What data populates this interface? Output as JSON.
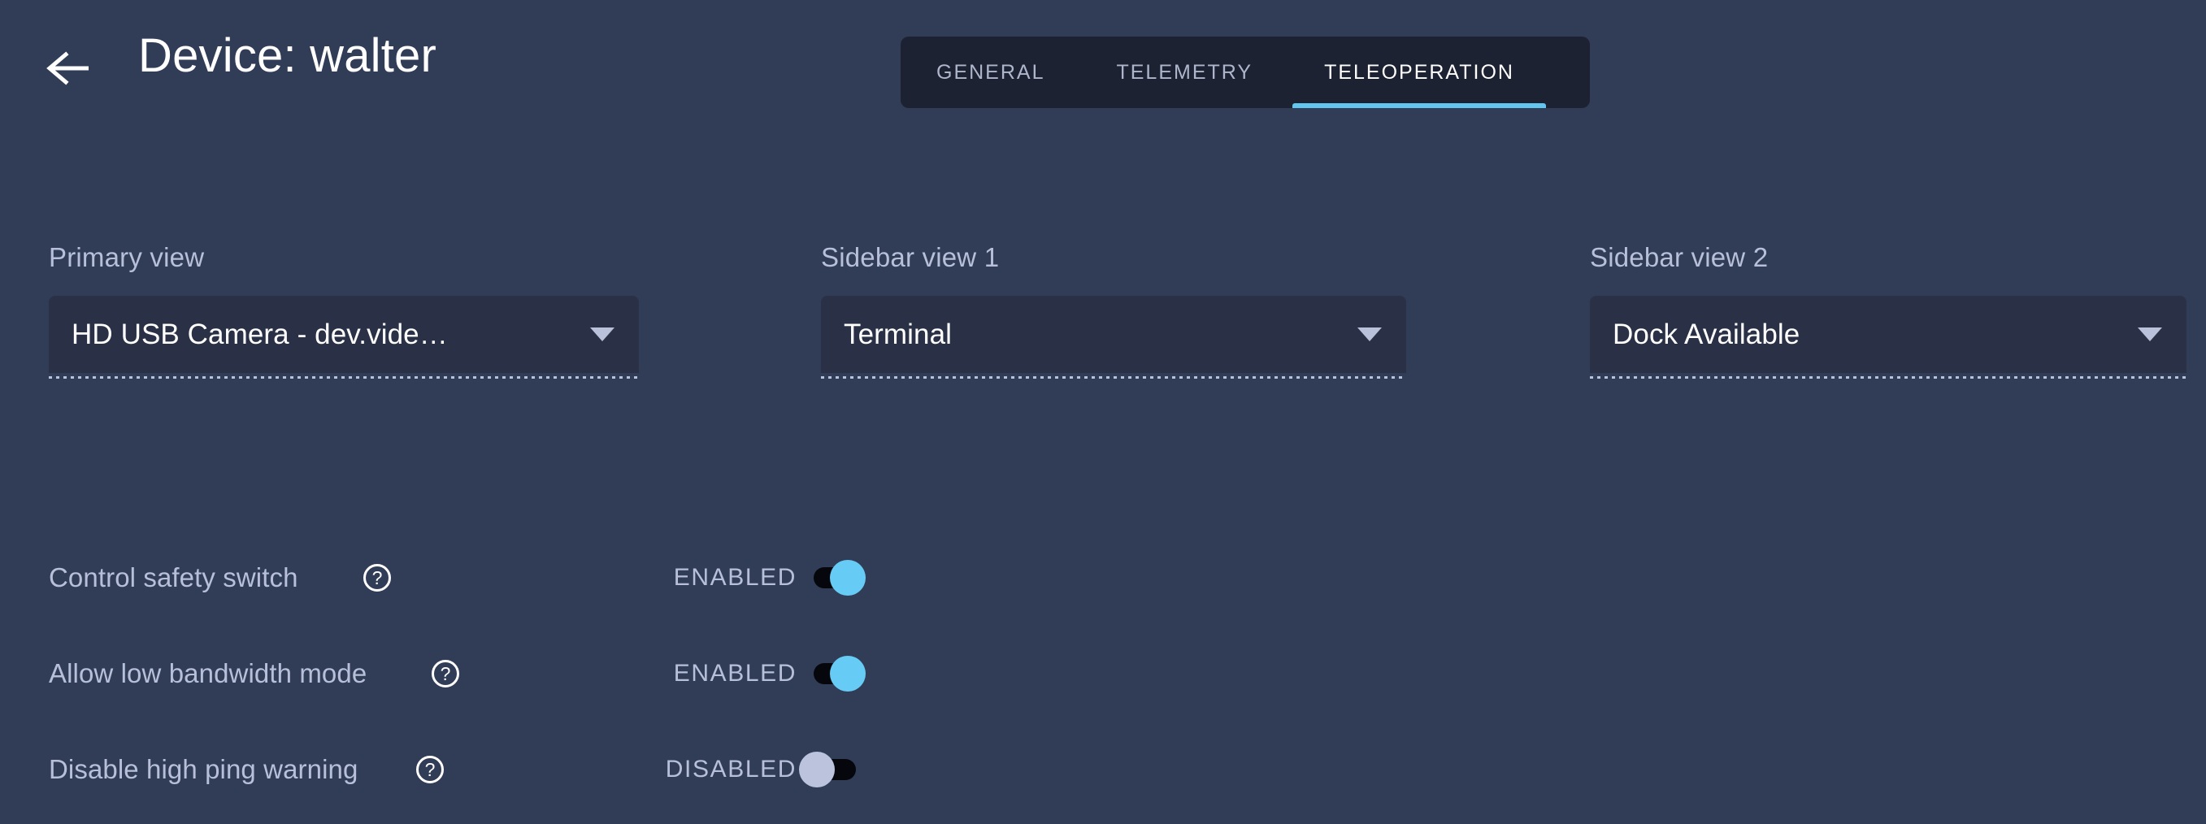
{
  "header": {
    "back_icon": "arrow-left-icon",
    "title": "Device: walter"
  },
  "tabs": [
    {
      "label": "GENERAL",
      "active": false
    },
    {
      "label": "TELEMETRY",
      "active": false
    },
    {
      "label": "TELEOPERATION",
      "active": true
    }
  ],
  "selects": [
    {
      "label": "Primary view",
      "value": "HD USB Camera - dev.vide…",
      "caret_icon": "chevron-down-icon"
    },
    {
      "label": "Sidebar view 1",
      "value": "Terminal",
      "caret_icon": "chevron-down-icon"
    },
    {
      "label": "Sidebar view 2",
      "value": "Dock Available",
      "caret_icon": "chevron-down-icon"
    }
  ],
  "toggles": [
    {
      "label": "Control safety switch",
      "help_icon": "help-circle-icon",
      "help_glyph": "?",
      "state_label": "ENABLED",
      "enabled": true
    },
    {
      "label": "Allow low bandwidth mode",
      "help_icon": "help-circle-icon",
      "help_glyph": "?",
      "state_label": "ENABLED",
      "enabled": true
    },
    {
      "label": "Disable high ping warning",
      "help_icon": "help-circle-icon",
      "help_glyph": "?",
      "state_label": "DISABLED",
      "enabled": false
    }
  ],
  "colors": {
    "page_background": "#313c57",
    "tabbar_background": "#1d2233",
    "select_background": "#2a3147",
    "accent": "#62c6ef",
    "toggle_on_knob": "#66ccf5",
    "toggle_off_knob": "#bcc4dd",
    "toggle_track": "#05070d",
    "muted_text": "#b7c0d8",
    "primary_text": "#ffffff"
  }
}
